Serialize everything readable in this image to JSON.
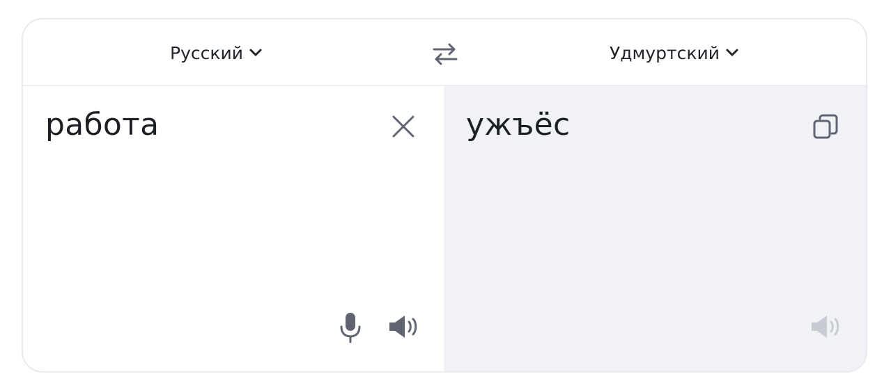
{
  "header": {
    "source_language": "Русский",
    "target_language": "Удмуртский"
  },
  "source": {
    "text": "работа"
  },
  "target": {
    "text": "ужъёс"
  },
  "colors": {
    "text": "#1c1f24",
    "icon": "#5f6470",
    "icon_disabled": "#c9cbd3",
    "target_background": "#f1f2f7"
  },
  "icons": {
    "source_dropdown": "chevron-down-icon",
    "target_dropdown": "chevron-down-icon",
    "swap": "swap-arrows-icon",
    "clear": "close-icon",
    "copy": "copy-icon",
    "microphone": "microphone-icon",
    "source_speaker": "speaker-icon",
    "target_speaker": "speaker-icon"
  }
}
